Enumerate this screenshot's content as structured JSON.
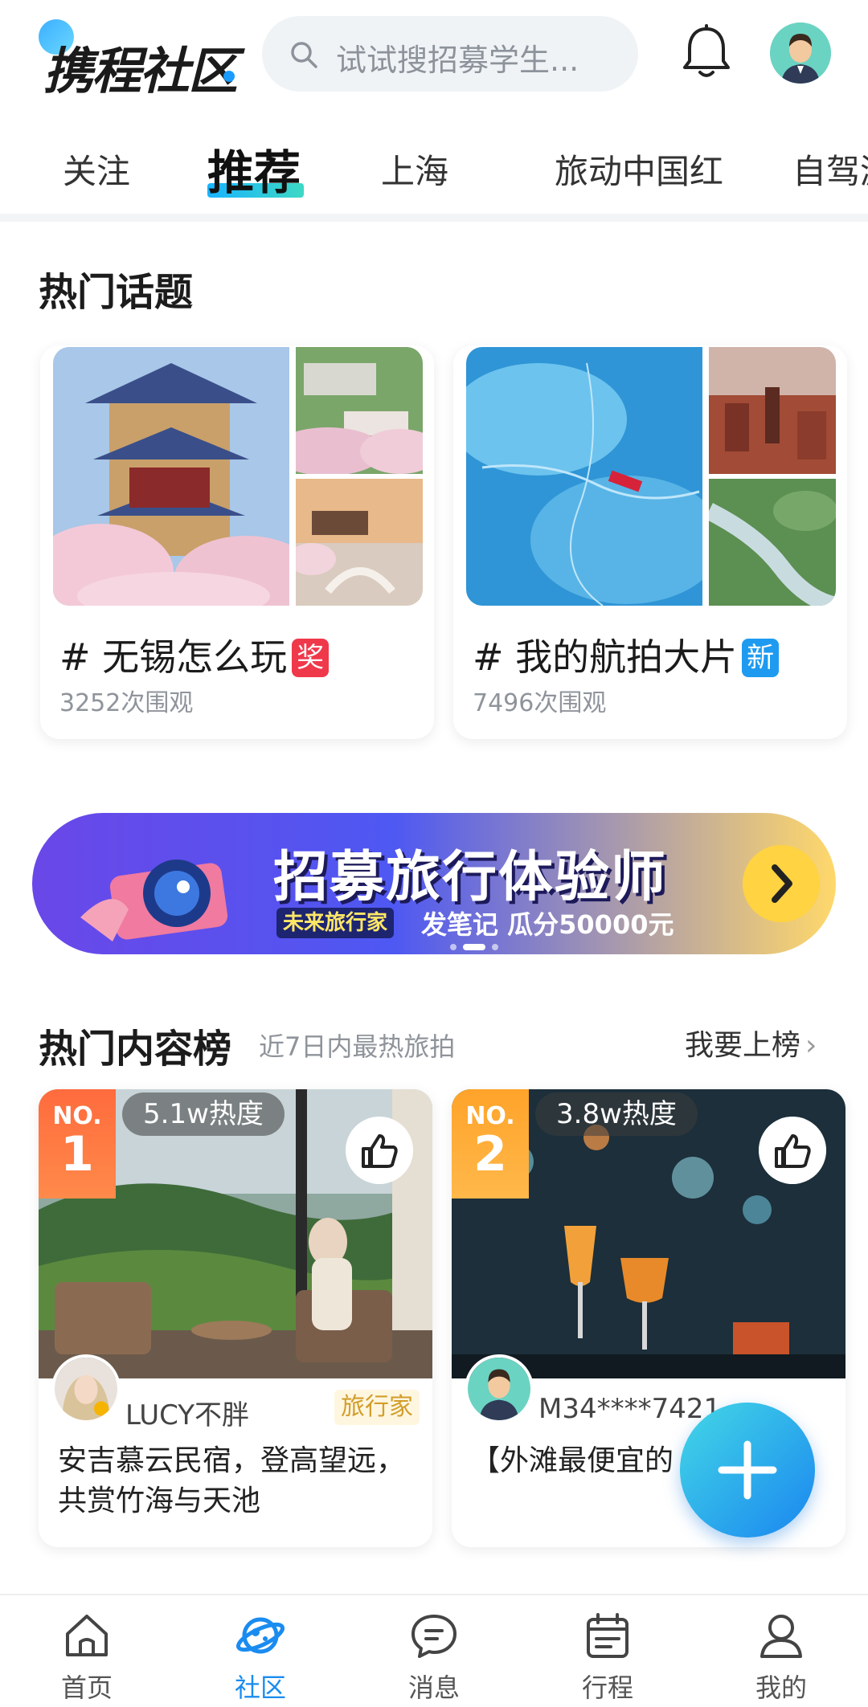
{
  "header": {
    "logo_text": "携程社区",
    "search_placeholder": "试试搜招募学生..."
  },
  "tabs": [
    {
      "label": "关注"
    },
    {
      "label": "推荐"
    },
    {
      "label": "上海"
    },
    {
      "label": "旅动中国红"
    },
    {
      "label": "自驾游"
    }
  ],
  "hot_topics": {
    "title": "热门话题",
    "items": [
      {
        "name": "# 无锡怎么玩",
        "badge": "奖",
        "badge_color": "#f0384b",
        "views": "3252次围观"
      },
      {
        "name": "# 我的航拍大片",
        "badge": "新",
        "badge_color": "#1e9bf0",
        "views": "7496次围观"
      }
    ]
  },
  "banner": {
    "title": "招募旅行体验师",
    "tag": "未来旅行家",
    "subtitle": "发笔记 瓜分50000元"
  },
  "ranking": {
    "title": "热门内容榜",
    "subtitle": "近7日内最热旅拍",
    "more": "我要上榜",
    "items": [
      {
        "no_label": "NO.",
        "rank": "1",
        "heat": "5.1w热度",
        "author": "LUCY不胖",
        "author_tag": "旅行家",
        "desc": "安吉慕云民宿，登高望远，共赏竹海与天池"
      },
      {
        "no_label": "NO.",
        "rank": "2",
        "heat": "3.8w热度",
        "author": "M34****7421",
        "author_tag": "",
        "desc": "【外滩最便宜的"
      }
    ]
  },
  "bottom_nav": [
    {
      "label": "首页",
      "icon": "home-icon"
    },
    {
      "label": "社区",
      "icon": "community-planet-icon"
    },
    {
      "label": "消息",
      "icon": "message-icon"
    },
    {
      "label": "行程",
      "icon": "calendar-icon"
    },
    {
      "label": "我的",
      "icon": "profile-icon"
    }
  ],
  "colors": {
    "accent": "#1a8cf0",
    "rank1": "#ff6b3d",
    "rank2": "#ffa32a"
  }
}
